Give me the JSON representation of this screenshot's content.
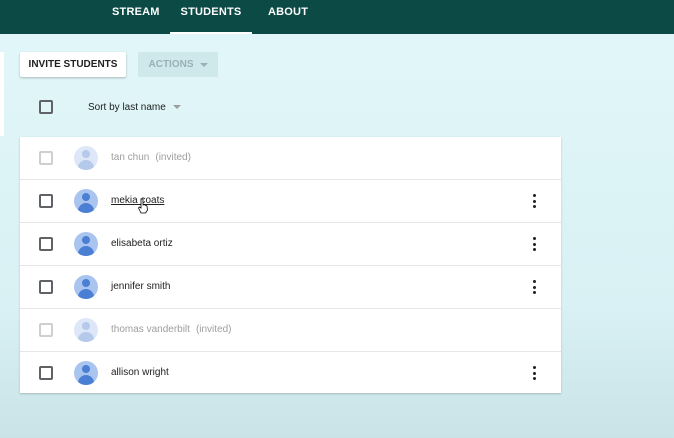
{
  "topbar": {
    "tabs": [
      {
        "label": "STREAM",
        "active": false
      },
      {
        "label": "STUDENTS",
        "active": true
      },
      {
        "label": "ABOUT",
        "active": false
      }
    ],
    "color": "#0b4a45"
  },
  "toolbar": {
    "invite_label": "INVITE STUDENTS",
    "actions_label": "ACTIONS"
  },
  "sort": {
    "label": "Sort by last name"
  },
  "students": [
    {
      "name": "tan chun",
      "status": "(invited)",
      "invited": true
    },
    {
      "name": "mekia coats",
      "status": "",
      "invited": false
    },
    {
      "name": "elisabeta ortiz",
      "status": "",
      "invited": false
    },
    {
      "name": "jennifer smith",
      "status": "",
      "invited": false
    },
    {
      "name": "thomas vanderbilt",
      "status": "(invited)",
      "invited": true
    },
    {
      "name": "allison wright",
      "status": "",
      "invited": false
    }
  ]
}
